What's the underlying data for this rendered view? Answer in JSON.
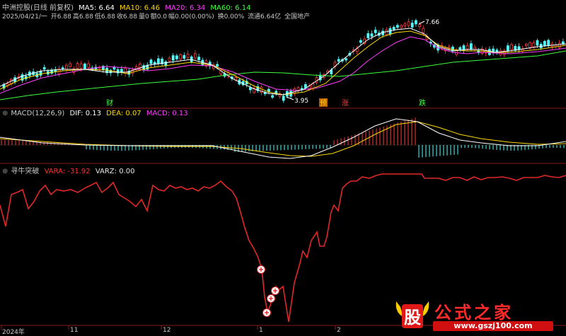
{
  "title": {
    "name": "中洲控股(日线 前复权)",
    "ma5": "MA5: 6.64",
    "ma10": "MA10: 6.46",
    "ma20": "MA20: 6.34",
    "ma60": "MA60: 6.14"
  },
  "info": {
    "date": "2025/04/21/一",
    "open": "开6.88",
    "high": "高6.88",
    "low": "低6.88",
    "close": "收6.88",
    "volume": "量0",
    "amount": "额0.0",
    "change": "幅0.00(0.00%)",
    "turnover": "换0.00%",
    "float": "流通6.64亿",
    "sector": "全国地产"
  },
  "annotations": {
    "high_price": "7.66",
    "low_price": "3.95",
    "label_cai": "财",
    "label_yu": "预",
    "label_zhang": "涨",
    "label_die": "跌"
  },
  "macd": {
    "name": "MACD(12,26,9)",
    "dif": "DIF: 0.13",
    "dea": "DEA: 0.07",
    "macd": "MACD: 0.13"
  },
  "indicator": {
    "name": "寻牛突破",
    "vara": "VARA: -31.92",
    "varz": "VARZ: 0.00"
  },
  "x_axis": [
    "2024年",
    "11",
    "12",
    "1",
    "2"
  ],
  "watermark": {
    "logo_text": "股",
    "title": "公式之家",
    "url": "www.gszj100.com"
  },
  "colors": {
    "background": "#000000",
    "up": "#ff3c3c",
    "down": "#54ffff",
    "ma5": "#ffffff",
    "ma10": "#ffd700",
    "ma20": "#ff3cff",
    "ma60": "#3cff3c",
    "vara": "#e02828",
    "divider": "#8a1a1a"
  }
}
